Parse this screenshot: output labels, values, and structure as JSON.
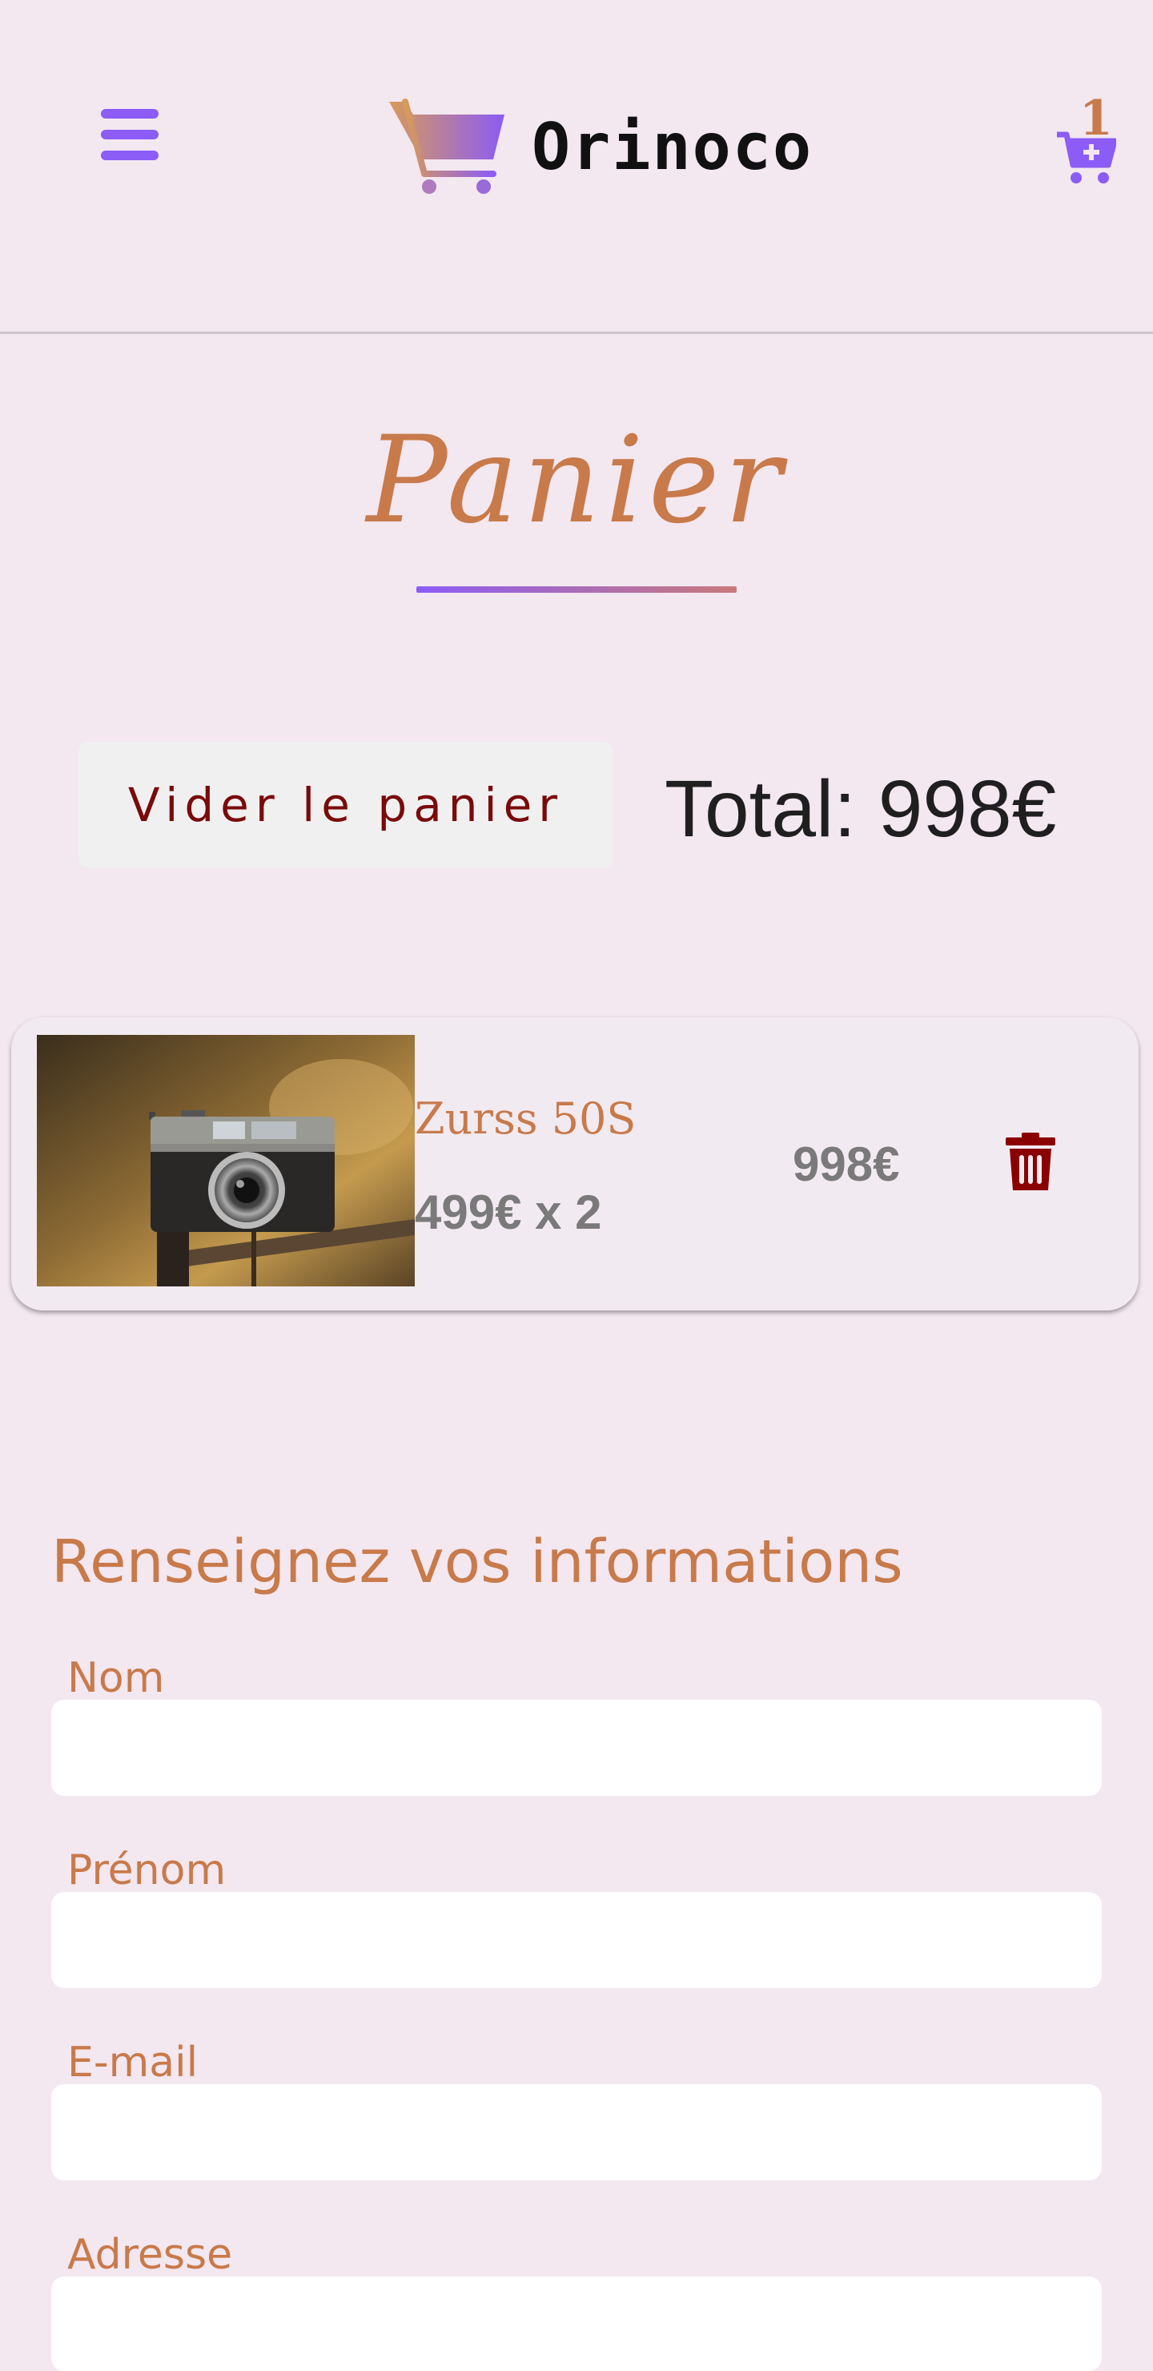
{
  "header": {
    "brand": "Orinoco",
    "cart_count": "1"
  },
  "page": {
    "title": "Panier"
  },
  "cart": {
    "clear_label": "Vider le panier",
    "total_label": "Total: 998€",
    "items": [
      {
        "name": "Zurss 50S",
        "unit_line": "499€ x 2",
        "line_total": "998€"
      }
    ]
  },
  "form": {
    "title": "Renseignez vos informations",
    "fields": [
      {
        "label": "Nom",
        "value": "",
        "placeholder": ""
      },
      {
        "label": "Prénom",
        "value": "",
        "placeholder": ""
      },
      {
        "label": "E-mail",
        "value": "",
        "placeholder": ""
      },
      {
        "label": "Adresse",
        "value": "",
        "placeholder": ""
      }
    ]
  },
  "icons": {
    "menu": "hamburger-menu-icon",
    "logo": "shopping-cart-logo-icon",
    "cart": "cart-plus-icon",
    "delete": "trash-icon"
  },
  "colors": {
    "background": "#f3e7f0",
    "accent_purple": "#8b5cf6",
    "accent_copper": "#c87a4a",
    "danger": "#8b0000"
  }
}
